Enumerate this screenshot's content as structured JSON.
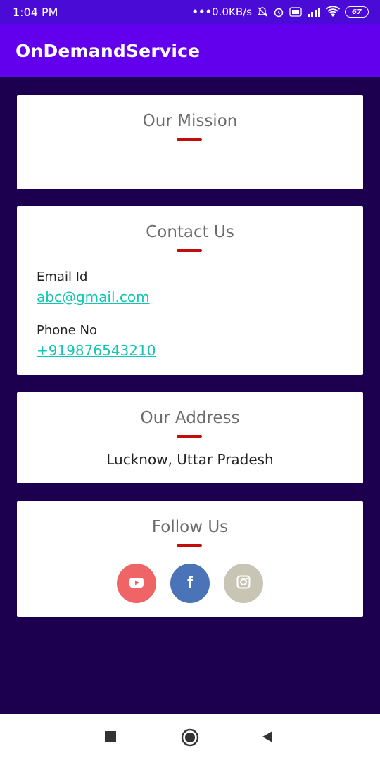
{
  "status": {
    "time": "1:04 PM",
    "speed": "0.0KB/s",
    "battery": "67"
  },
  "app": {
    "title": "OnDemandService"
  },
  "cards": {
    "mission": {
      "title": "Our Mission"
    },
    "contact": {
      "title": "Contact Us",
      "email_label": "Email Id",
      "email": "abc@gmail.com",
      "phone_label": "Phone No",
      "phone": "+919876543210"
    },
    "address": {
      "title": "Our Address",
      "value": "Lucknow, Uttar Pradesh"
    },
    "follow": {
      "title": "Follow Us",
      "icons": [
        "youtube-icon",
        "facebook-icon",
        "instagram-icon"
      ]
    }
  },
  "colors": {
    "status_bar": "#4a0bd6",
    "app_bar": "#6200ee",
    "background": "#1c004f",
    "accent_underline": "#c30d0d",
    "link": "#13c6b3",
    "youtube": "#ef6466",
    "facebook": "#4b73b8",
    "instagram": "#c9c5b5"
  }
}
